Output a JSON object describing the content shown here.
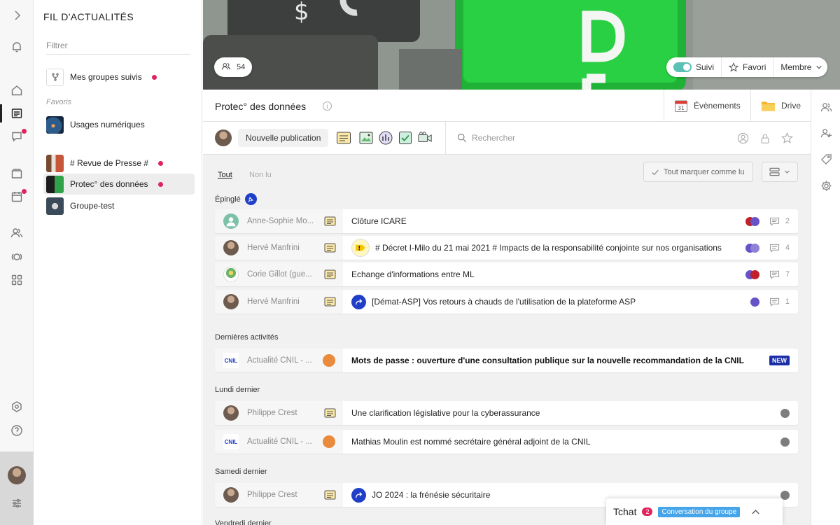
{
  "colors": {
    "accent_pink": "#e0245e",
    "toggle_teal": "#5cc0b6",
    "blue_icon": "#1f3fc8",
    "purple": "#6752c8",
    "red": "#c0202a",
    "orange": "#e98a3d"
  },
  "sidebar": {
    "title": "FIL D'ACTUALITÉS",
    "filter_placeholder": "Filtrer",
    "followed_label": "Mes groupes suivis",
    "favorites_label": "Favoris",
    "favorites": [
      "Usages numériques"
    ],
    "groups": [
      {
        "label": "# Revue de Presse #",
        "unread": true
      },
      {
        "label": "Protec° des données",
        "unread": true,
        "selected": true
      },
      {
        "label": "Groupe-test",
        "unread": false
      }
    ]
  },
  "banner": {
    "members_count": "54",
    "follow_label": "Suivi",
    "favorite_label": "Favori",
    "member_label": "Membre"
  },
  "header": {
    "group_name": "Protec° des données",
    "events_label": "Évènements",
    "drive_label": "Drive"
  },
  "composer": {
    "new_post_label": "Nouvelle publication",
    "search_placeholder": "Rechercher"
  },
  "feed": {
    "tabs": [
      "Tout",
      "Non lu"
    ],
    "mark_all_read": "Tout marquer comme lu",
    "pinned_label": "Épinglé",
    "pinned": [
      {
        "author": "Anne-Sophie Mo...",
        "title": "Clôture ICARE",
        "comments": "2",
        "indicator": "red-purple"
      },
      {
        "author": "Hervé Manfrini",
        "title": "# Décret I-Milo du 21 mai 2021 # Impacts de la responsabilité conjointe sur nos organisations",
        "comments": "4",
        "indicator": "purple-purple",
        "tag": "warning"
      },
      {
        "author": "Corie Gillot (gue...",
        "title": "Echange d'informations entre ML",
        "comments": "7",
        "indicator": "purple-red"
      },
      {
        "author": "Hervé Manfrini",
        "title": "[Démat-ASP] Vos retours à chauds de l'utilisation de la plateforme ASP",
        "comments": "1",
        "indicator": "purple",
        "tag": "share"
      }
    ],
    "sections": [
      {
        "label": "Dernières activités",
        "rows": [
          {
            "author": "Actualité CNIL - ...",
            "title": "Mots de passe : ouverture d'une consultation publique sur la nouvelle recommandation de la CNIL",
            "badge": "NEW",
            "bold": true
          }
        ]
      },
      {
        "label": "Lundi dernier",
        "rows": [
          {
            "author": "Philippe Crest",
            "title": "Une clarification législative pour la cyberassurance"
          },
          {
            "author": "Actualité CNIL - ...",
            "title": "Mathias Moulin est nommé secrétaire général adjoint de la CNIL"
          }
        ]
      },
      {
        "label": "Samedi dernier",
        "rows": [
          {
            "author": "Philippe Crest",
            "title": "JO 2024 : la frénésie sécuritaire",
            "tag": "share"
          }
        ]
      },
      {
        "label": "Vendredi dernier",
        "rows": []
      }
    ]
  },
  "chat": {
    "title": "Tchat",
    "count": "2",
    "conversation_label": "Conversation du groupe"
  },
  "icons": {
    "left_rail": [
      "chevron-right-icon",
      "bell-icon",
      "home-icon",
      "newsfeed-icon",
      "messages-icon",
      "folder-icon",
      "calendar-icon",
      "people-icon",
      "groups-icon",
      "apps-icon",
      "settings-icon",
      "help-icon",
      "sliders-icon"
    ],
    "right_rail": [
      "members-icon",
      "add-member-icon",
      "tag-icon",
      "gear-icon"
    ]
  }
}
